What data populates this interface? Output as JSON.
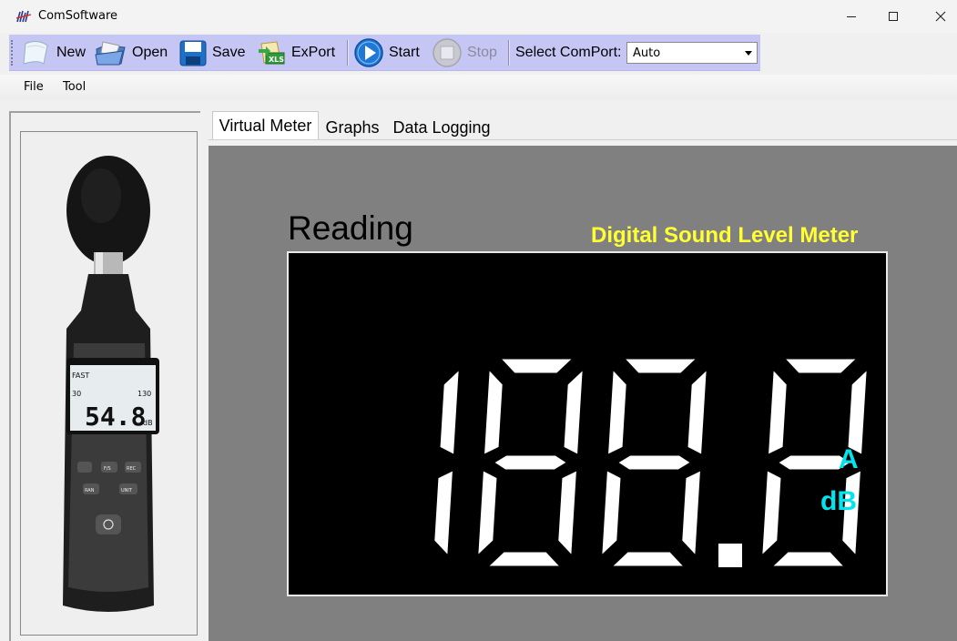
{
  "window": {
    "title": "ComSoftware",
    "controls": [
      "minimize",
      "maximize",
      "close"
    ]
  },
  "toolbar": {
    "new_label": "New",
    "open_label": "Open",
    "save_label": "Save",
    "export_label": "ExPort",
    "start_label": "Start",
    "stop_label": "Stop",
    "comport_label": "Select ComPort:",
    "comport_value": "Auto"
  },
  "menu": {
    "items": [
      {
        "label": "File"
      },
      {
        "label": "Tool"
      }
    ]
  },
  "tabs": [
    {
      "label": "Virtual Meter",
      "active": true
    },
    {
      "label": "Graphs",
      "active": false
    },
    {
      "label": "Data Logging",
      "active": false
    }
  ],
  "meter": {
    "heading": "Reading",
    "title": "Digital Sound Level Meter",
    "display_value": "188.8",
    "weighting": "A",
    "unit": "dB",
    "colors": {
      "background": "#808080",
      "screen": "#000000",
      "digits": "#ffffff",
      "title": "#ffff33",
      "unit": "#00e5ee"
    }
  },
  "device": {
    "lcd_mode": "FAST",
    "lcd_range_low": "30",
    "lcd_range_high": "130",
    "lcd_value": "54.8",
    "lcd_unit": "dB",
    "buttons": [
      "F/S",
      "REC",
      "RAN",
      "UNIT"
    ]
  }
}
